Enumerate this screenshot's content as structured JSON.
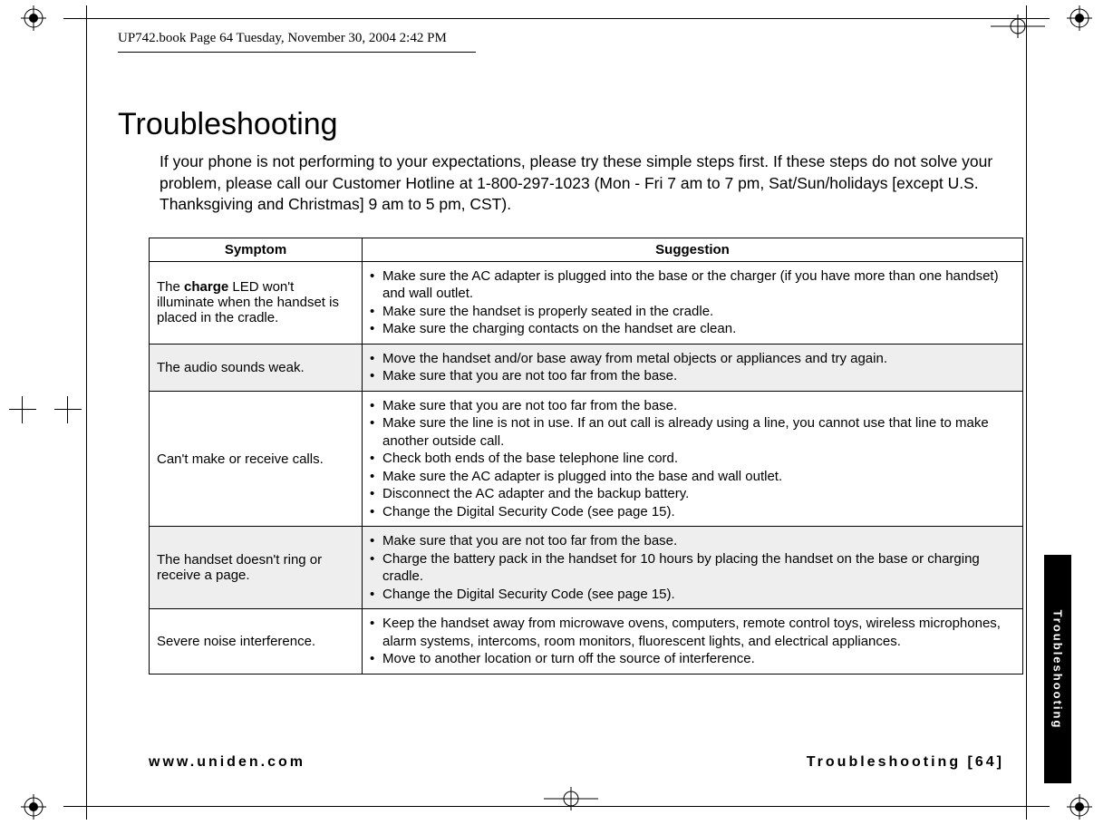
{
  "runhead": "UP742.book  Page 64  Tuesday, November 30, 2004  2:42 PM",
  "title": "Troubleshooting",
  "intro": "If your phone is not performing to your expectations, please try these simple steps first. If these steps do not solve your problem, please call our Customer Hotline at 1-800-297-1023 (Mon - Fri 7 am to 7 pm, Sat/Sun/holidays [except U.S. Thanksgiving and Christmas] 9 am to 5 pm, CST).",
  "table": {
    "head": {
      "symptom": "Symptom",
      "suggestion": "Suggestion"
    },
    "rows": [
      {
        "symptom_pre": "The ",
        "symptom_bold": "charge",
        "symptom_post": " LED won't illuminate when the handset is placed in the cradle.",
        "suggestions": [
          "Make sure the AC adapter is plugged into the base or the charger (if you have more than one handset) and wall outlet.",
          "Make sure the handset is properly seated in the cradle.",
          "Make sure the charging contacts on the handset are clean."
        ]
      },
      {
        "symptom": "The audio sounds weak.",
        "suggestions": [
          "Move the handset and/or base away from metal objects or appliances and try again.",
          "Make sure that you are not too far from the base."
        ]
      },
      {
        "symptom": "Can't make or receive calls.",
        "suggestions": [
          "Make sure that you are not too far from the base.",
          "Make sure the line is not in use. If an out call is already using a line, you cannot use that line to make another outside call.",
          "Check both ends of the base telephone line cord.",
          "Make sure the AC adapter is plugged into the base and wall outlet.",
          "Disconnect the AC adapter and the backup battery.",
          "Change the Digital Security Code (see page 15)."
        ]
      },
      {
        "symptom": "The handset doesn't ring or receive a page.",
        "suggestions": [
          "Make sure that you are not too far from the base.",
          "Charge the battery pack in the handset for 10 hours by placing the handset on the base or charging cradle.",
          "Change the Digital Security Code (see page 15)."
        ]
      },
      {
        "symptom": "Severe noise interference.",
        "suggestions": [
          "Keep the handset away from microwave ovens, computers, remote control toys, wireless microphones, alarm systems, intercoms, room monitors, fluorescent lights, and electrical appliances.",
          "Move to another location or turn off the source of interference."
        ]
      }
    ]
  },
  "footer": {
    "left": "www.uniden.com",
    "right": "Troubleshooting [64]"
  },
  "sidetab": "Troubleshooting"
}
